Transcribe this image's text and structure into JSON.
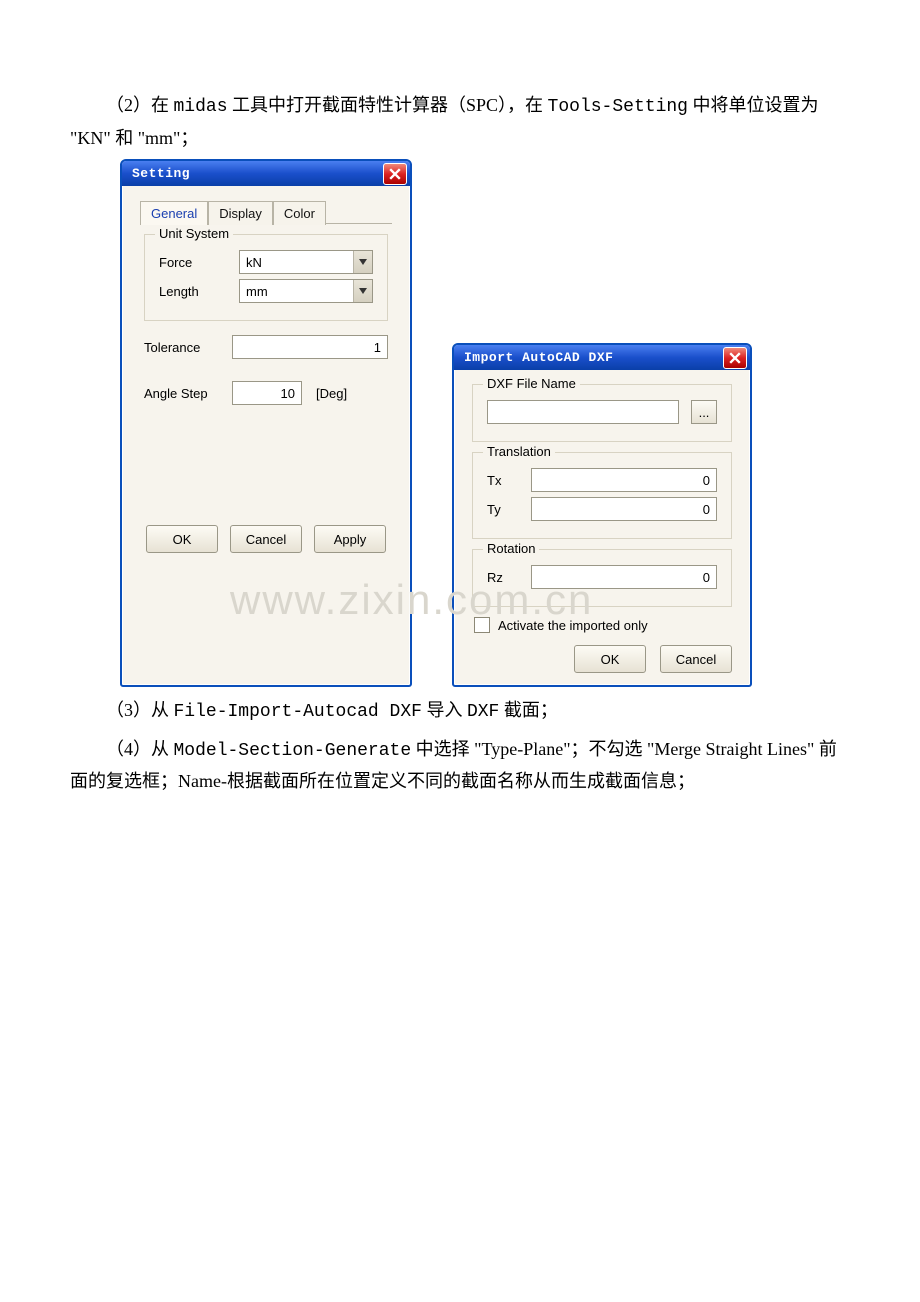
{
  "text": {
    "p1_pre": "（2）在 ",
    "p1_tool": "midas",
    "p1_mid": " 工具中打开截面特性计算器（SPC），在 ",
    "p1_menu": "Tools-Setting",
    "p1_post": " 中将单位设置为  \"KN\" 和 \"mm\"；",
    "p2_pre": "（3）从 ",
    "p2_menu": "File-Import-Autocad DXF",
    "p2_mid": " 导入 ",
    "p2_obj": "DXF",
    "p2_post": " 截面；",
    "p3_pre": "（4）从 ",
    "p3_menu": "Model-Section-Generate",
    "p3_mid": " 中选择 \"Type-Plane\"；不勾选 \"Merge Straight Lines\" 前面的复选框；Name-根据截面所在位置定义不同的截面名称从而生成截面信息；"
  },
  "watermark": "www.zixin.com.cn",
  "setting": {
    "title": "Setting",
    "tabs": {
      "general": "General",
      "display": "Display",
      "color": "Color"
    },
    "unit_legend": "Unit System",
    "force_label": "Force",
    "force_value": "kN",
    "length_label": "Length",
    "length_value": "mm",
    "tolerance_label": "Tolerance",
    "tolerance_value": "1",
    "anglestep_label": "Angle Step",
    "anglestep_value": "10",
    "anglestep_unit": "[Deg]",
    "ok": "OK",
    "cancel": "Cancel",
    "apply": "Apply"
  },
  "import": {
    "title": "Import AutoCAD DXF",
    "dxf_legend": "DXF File Name",
    "dxf_value": "",
    "browse": "...",
    "trans_legend": "Translation",
    "tx_label": "Tx",
    "tx_value": "0",
    "ty_label": "Ty",
    "ty_value": "0",
    "rot_legend": "Rotation",
    "rz_label": "Rz",
    "rz_value": "0",
    "activate_label": "Activate the imported only",
    "ok": "OK",
    "cancel": "Cancel"
  }
}
